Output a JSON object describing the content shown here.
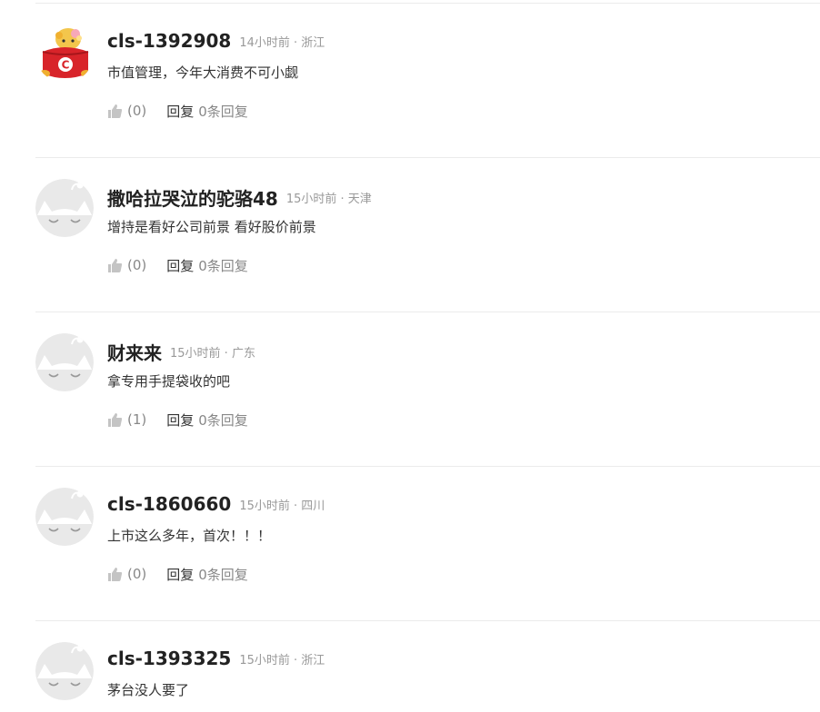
{
  "comments": [
    {
      "avatar": "orange-cartoon-avatar-icon",
      "username": "cls-1392908",
      "meta": "14小时前 · 浙江",
      "content": "市值管理，今年大消费不可小觑",
      "like_count": "(0)",
      "reply_label": "回复",
      "reply_count": "0条回复"
    },
    {
      "avatar": "default-cat-avatar-icon",
      "username": "撒哈拉哭泣的驼骆48",
      "meta": "15小时前 · 天津",
      "content": "增持是看好公司前景 看好股价前景",
      "like_count": "(0)",
      "reply_label": "回复",
      "reply_count": "0条回复"
    },
    {
      "avatar": "default-cat-avatar-icon",
      "username": "财来来",
      "meta": "15小时前 · 广东",
      "content": "拿专用手提袋收的吧",
      "like_count": "(1)",
      "reply_label": "回复",
      "reply_count": "0条回复"
    },
    {
      "avatar": "default-cat-avatar-icon",
      "username": "cls-1860660",
      "meta": "15小时前 · 四川",
      "content": "上市这么多年，首次！！！",
      "like_count": "(0)",
      "reply_label": "回复",
      "reply_count": "0条回复"
    },
    {
      "avatar": "default-cat-avatar-icon",
      "username": "cls-1393325",
      "meta": "15小时前 · 浙江",
      "content": "茅台没人要了",
      "like_count": "(0)",
      "reply_label": "回复",
      "reply_count": "0条回复"
    }
  ],
  "colors": {
    "username": "#222222",
    "meta": "#999999",
    "content": "#333333",
    "action": "#888888",
    "divider": "#ebebeb",
    "avatar_red": "#d8242a",
    "avatar_yellow": "#f3c64c"
  },
  "icons": {
    "like": "thumbs-up-icon"
  }
}
